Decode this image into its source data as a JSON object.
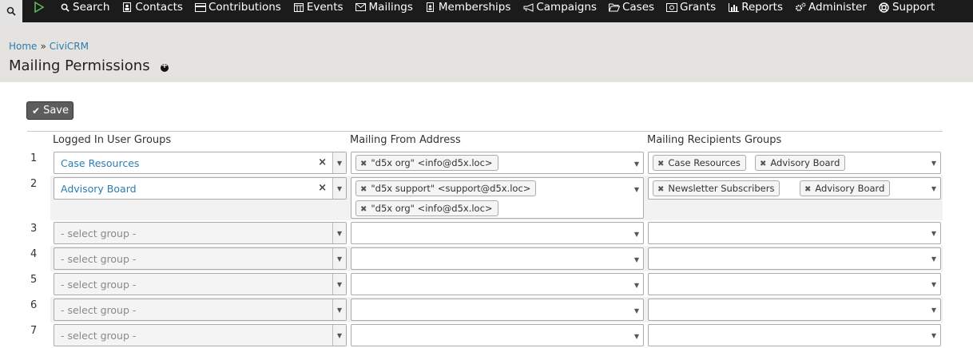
{
  "nav": {
    "items": [
      {
        "label": "Search",
        "icon": "search-icon"
      },
      {
        "label": "Contacts",
        "icon": "contacts-icon"
      },
      {
        "label": "Contributions",
        "icon": "credit-card-icon"
      },
      {
        "label": "Events",
        "icon": "calendar-icon"
      },
      {
        "label": "Mailings",
        "icon": "envelope-icon"
      },
      {
        "label": "Memberships",
        "icon": "id-badge-icon"
      },
      {
        "label": "Campaigns",
        "icon": "bullhorn-icon"
      },
      {
        "label": "Cases",
        "icon": "folder-icon"
      },
      {
        "label": "Grants",
        "icon": "money-icon"
      },
      {
        "label": "Reports",
        "icon": "bar-chart-icon"
      },
      {
        "label": "Administer",
        "icon": "gears-icon"
      },
      {
        "label": "Support",
        "icon": "life-ring-icon"
      }
    ]
  },
  "breadcrumb": {
    "home": "Home",
    "sep": "»",
    "civicrm": "CiviCRM"
  },
  "page": {
    "title": "Mailing Permissions"
  },
  "toolbar": {
    "save_label": "Save"
  },
  "table": {
    "headers": [
      "Logged In User Groups",
      "Mailing From Address",
      "Mailing Recipients Groups"
    ],
    "placeholder": "- select group -",
    "rows": [
      {
        "num": "1",
        "group": "Case Resources",
        "from": [
          "\"d5x org\" <info@d5x.loc>"
        ],
        "recipients": [
          "Case Resources",
          "Advisory Board"
        ]
      },
      {
        "num": "2",
        "group": "Advisory Board",
        "from": [
          "\"d5x support\" <support@d5x.loc>",
          "\"d5x org\" <info@d5x.loc>"
        ],
        "recipients": [
          "Newsletter Subscribers",
          "Advisory Board"
        ]
      },
      {
        "num": "3",
        "group": "",
        "from": [],
        "recipients": []
      },
      {
        "num": "4",
        "group": "",
        "from": [],
        "recipients": []
      },
      {
        "num": "5",
        "group": "",
        "from": [],
        "recipients": []
      },
      {
        "num": "6",
        "group": "",
        "from": [],
        "recipients": []
      },
      {
        "num": "7",
        "group": "",
        "from": [],
        "recipients": []
      }
    ]
  },
  "colors": {
    "nav_bg": "#1b1b1b",
    "header_bg": "#e4e3df",
    "link": "#2a7db2",
    "save_bg": "#5d5d5d"
  }
}
